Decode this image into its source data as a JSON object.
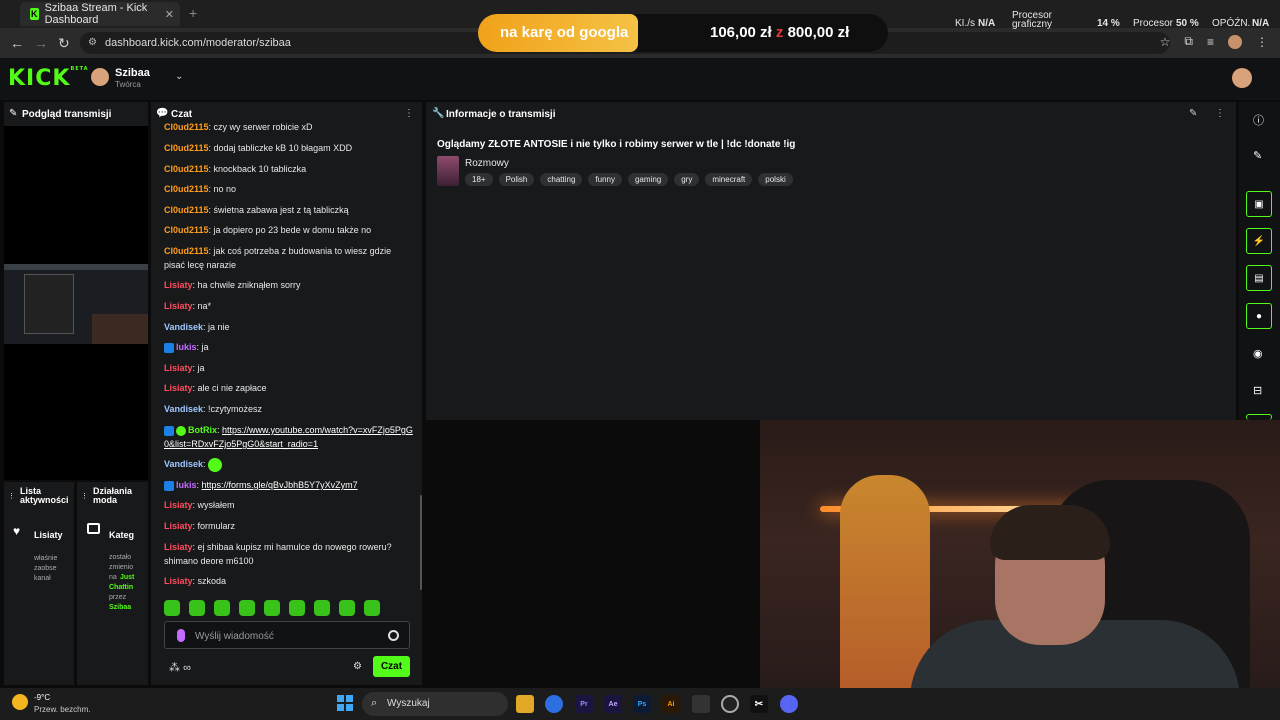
{
  "browser": {
    "tab_title": "Szibaa Stream - Kick Dashboard",
    "url": "dashboard.kick.com/moderator/szibaa"
  },
  "overlay": {
    "banner_text": "na karę od googla",
    "amount_current": "106,00 zł",
    "amount_separator": "z",
    "amount_goal": "800,00 zł",
    "stat_kbs_label": "KI./s",
    "stat_kbs_value": "N/A",
    "stat_gpu_label1": "Procesor",
    "stat_gpu_label2": "graficzny",
    "stat_gpu_value": "14 %",
    "stat_cpu_label": "Procesor",
    "stat_cpu_value": "50 %",
    "stat_delay_label": "OPÓŹN.",
    "stat_delay_value": "N/A"
  },
  "header": {
    "logo": "KICK",
    "logo_beta": "BETA",
    "channel_name": "Szibaa",
    "channel_role": "Twórca"
  },
  "panels": {
    "preview_title": "Podgląd transmisji",
    "chat_title": "Czat",
    "info_title": "Informacje o transmisji",
    "activity_title_1": "Lista",
    "activity_title_2": "aktywności",
    "mod_title_1": "Działania",
    "mod_title_2": "moda"
  },
  "activity": {
    "user": "Lisiaty",
    "line1": "właśnie",
    "line2": "zaobse",
    "line3": "kanał"
  },
  "mod_actions": {
    "label": "Kateg",
    "line1": "zostało",
    "line2": "zmienio",
    "line3": "na",
    "highlight1": "Just",
    "highlight2": "Chattin",
    "line4": "przez",
    "highlight3": "Szibaa"
  },
  "chat": {
    "messages": [
      {
        "user": "Cl0ud2115",
        "text": ": czy wy serwer robicie xD"
      },
      {
        "user": "Cl0ud2115",
        "text": ": dodaj tabliczke kB 10 błagam XDD"
      },
      {
        "user": "Cl0ud2115",
        "text": ": knockback 10 tabliczka"
      },
      {
        "user": "Cl0ud2115",
        "text": ": no no"
      },
      {
        "user": "Cl0ud2115",
        "text": ": świetna zabawa jest z tą tabliczką"
      },
      {
        "user": "Cl0ud2115",
        "text": ": ja dopiero po 23 bede w domu także no"
      },
      {
        "user": "Cl0ud2115",
        "text": ": jak coś potrzeba z budowania to wiesz gdzie pisać lecę narazie"
      },
      {
        "user": "Lisiaty",
        "text": ": ha chwile zniknąłem sorry"
      },
      {
        "user": "Lisiaty",
        "text": ": na*"
      },
      {
        "user": "Vandisek",
        "text": ": ja nie"
      },
      {
        "user": "lukis",
        "text": ": ja"
      },
      {
        "user": "Lisiaty",
        "text": ": ja"
      },
      {
        "user": "Lisiaty",
        "text": ": ale ci nie zapłace"
      },
      {
        "user": "Vandisek",
        "text": ": !czytymożesz"
      },
      {
        "user": "BotRix",
        "text": ": ",
        "link": "https://www.youtube.com/watch?v=xvFZjo5PgG0&list=RDxvFZjo5PgG0&start_radio=1"
      },
      {
        "user": "Vandisek",
        "text": ": "
      },
      {
        "user": "lukis",
        "text": ": ",
        "link": "https://forms.gle/qBvJbhB5Y7yXvZym7"
      },
      {
        "user": "Lisiaty",
        "text": ": wysłałem"
      },
      {
        "user": "Lisiaty",
        "text": ": formularz"
      },
      {
        "user": "Lisiaty",
        "text": ": ej shibaa kupisz mi hamulce do nowego roweru? shimano deore m6100"
      },
      {
        "user": "Lisiaty",
        "text": ": szkoda"
      }
    ],
    "input_placeholder": "Wyślij wiadomość",
    "send_label": "Czat",
    "points_label": "∞"
  },
  "stream_info": {
    "title": "Oglądamy ZŁOTE ANTOSIE i nie tylko i robimy serwer w tle | !dc !donate !ig",
    "category": "Rozmowy",
    "tags": [
      "18+",
      "Polish",
      "chatting",
      "funny",
      "gaming",
      "gry",
      "minecraft",
      "polski"
    ]
  },
  "taskbar": {
    "weather_temp": "-9°C",
    "weather_desc": "Przew. bezchm.",
    "search_label": "Wyszukaj",
    "apps": [
      "Pr",
      "Ae",
      "Ps",
      "Ai"
    ]
  },
  "colors": {
    "kick_green": "#53fc18",
    "panel_bg": "#18191b",
    "user_orange": "#ff9d1c",
    "user_red": "#ff4d5e",
    "user_blue": "#9ec8ff",
    "user_purple": "#c46cff"
  }
}
